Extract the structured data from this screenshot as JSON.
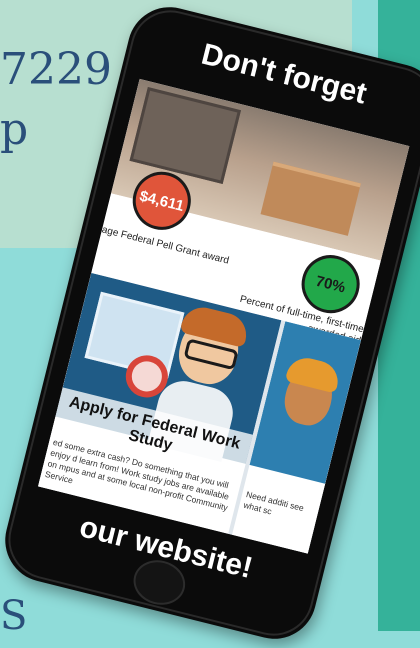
{
  "background": {
    "top_text_line1": "7229",
    "top_text_line2": "p",
    "bottom_text": "S",
    "colors": {
      "panel": "#b7dfd0",
      "page": "#8fdcd9",
      "stripe": "#35b29a",
      "text": "#2a4f7a"
    }
  },
  "phone": {
    "header": "Don't forget",
    "footer": "our website!"
  },
  "screen": {
    "stats": [
      {
        "value": "$4,611",
        "label": "age Federal Pell Grant award",
        "color": "#e0553a"
      },
      {
        "value": "70%",
        "label": "Percent of full-time, first-time awarded aid",
        "color": "#22a84a"
      }
    ],
    "cards": [
      {
        "title": "Apply for Federal Work Study",
        "text": "ed some extra cash? Do something that you will enjoy d learn from! Work study jobs are available on mpus and at some local non-profit Community Service"
      },
      {
        "title": "",
        "text": "Need additi see what sc"
      }
    ]
  }
}
